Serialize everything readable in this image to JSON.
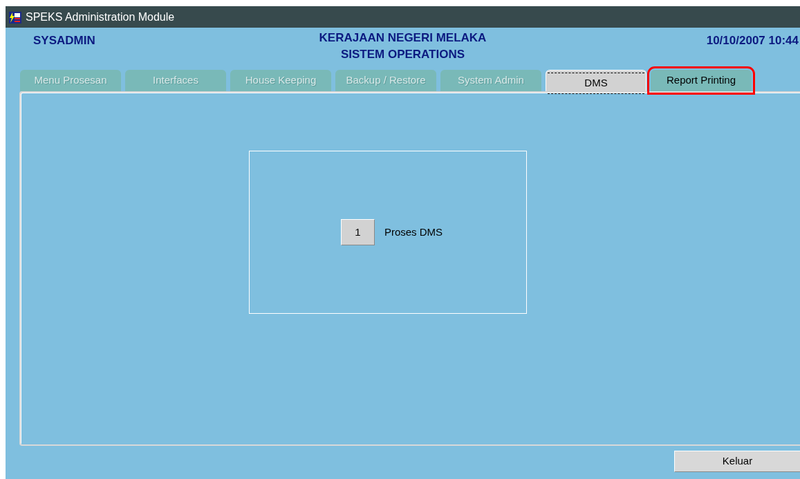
{
  "window": {
    "title": "SPEKS Administration Module"
  },
  "header": {
    "user": "SYSADMIN",
    "org_lines": [
      "KERAJAAN NEGERI MELAKA",
      "SISTEM OPERATIONS"
    ],
    "datetime": "10/10/2007 10:44"
  },
  "tabs": [
    {
      "label": "Menu Prosesan",
      "selected": false,
      "disabled": true,
      "highlighted": false
    },
    {
      "label": "Interfaces",
      "selected": false,
      "disabled": true,
      "highlighted": false
    },
    {
      "label": "House Keeping",
      "selected": false,
      "disabled": true,
      "highlighted": false
    },
    {
      "label": "Backup / Restore",
      "selected": false,
      "disabled": true,
      "highlighted": false
    },
    {
      "label": "System Admin",
      "selected": false,
      "disabled": true,
      "highlighted": false
    },
    {
      "label": "DMS",
      "selected": true,
      "disabled": false,
      "highlighted": false
    },
    {
      "label": "Report Printing",
      "selected": false,
      "disabled": false,
      "highlighted": true
    }
  ],
  "menu_items": [
    {
      "key": "1",
      "label": "Proses DMS"
    }
  ],
  "footer": {
    "exit_button": "Keluar"
  }
}
